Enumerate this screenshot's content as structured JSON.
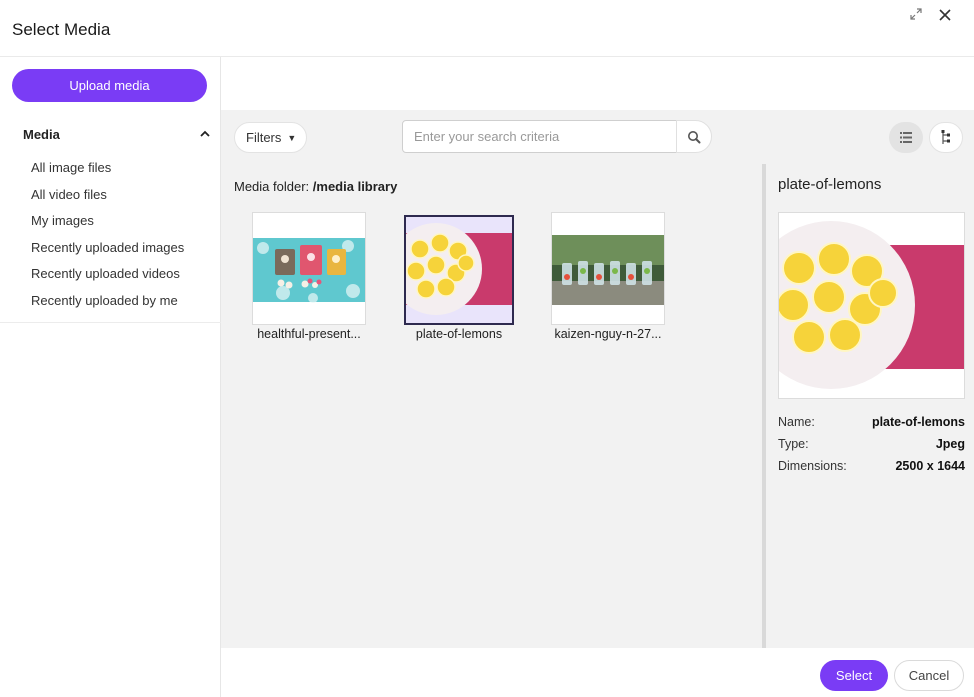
{
  "dialog": {
    "title": "Select Media",
    "maximize_icon": "expand-icon",
    "close_icon": "close-icon"
  },
  "sidebar": {
    "upload_label": "Upload media",
    "section_title": "Media",
    "items": [
      {
        "label": "All image files"
      },
      {
        "label": "All video files"
      },
      {
        "label": "My images"
      },
      {
        "label": "Recently uploaded images"
      },
      {
        "label": "Recently uploaded videos"
      },
      {
        "label": "Recently uploaded by me"
      }
    ]
  },
  "toolbar": {
    "filters_label": "Filters",
    "search_placeholder": "Enter your search criteria",
    "search_value": ""
  },
  "folder": {
    "prefix": "Media folder:",
    "path": "/media library"
  },
  "tiles": [
    {
      "label": "healthful-present...",
      "selected": false
    },
    {
      "label": "plate-of-lemons",
      "selected": true
    },
    {
      "label": "kaizen-nguy-n-27...",
      "selected": false
    }
  ],
  "details": {
    "title": "plate-of-lemons",
    "name_label": "Name:",
    "name_value": "plate-of-lemons",
    "type_label": "Type:",
    "type_value": "Jpeg",
    "dimensions_label": "Dimensions:",
    "dimensions_value": "2500 x 1644"
  },
  "footer": {
    "select_label": "Select",
    "cancel_label": "Cancel"
  },
  "colors": {
    "accent": "#7a3cf5",
    "panel_bg": "#f2f2f2",
    "selected_tile_bg": "#e9e4fb"
  }
}
